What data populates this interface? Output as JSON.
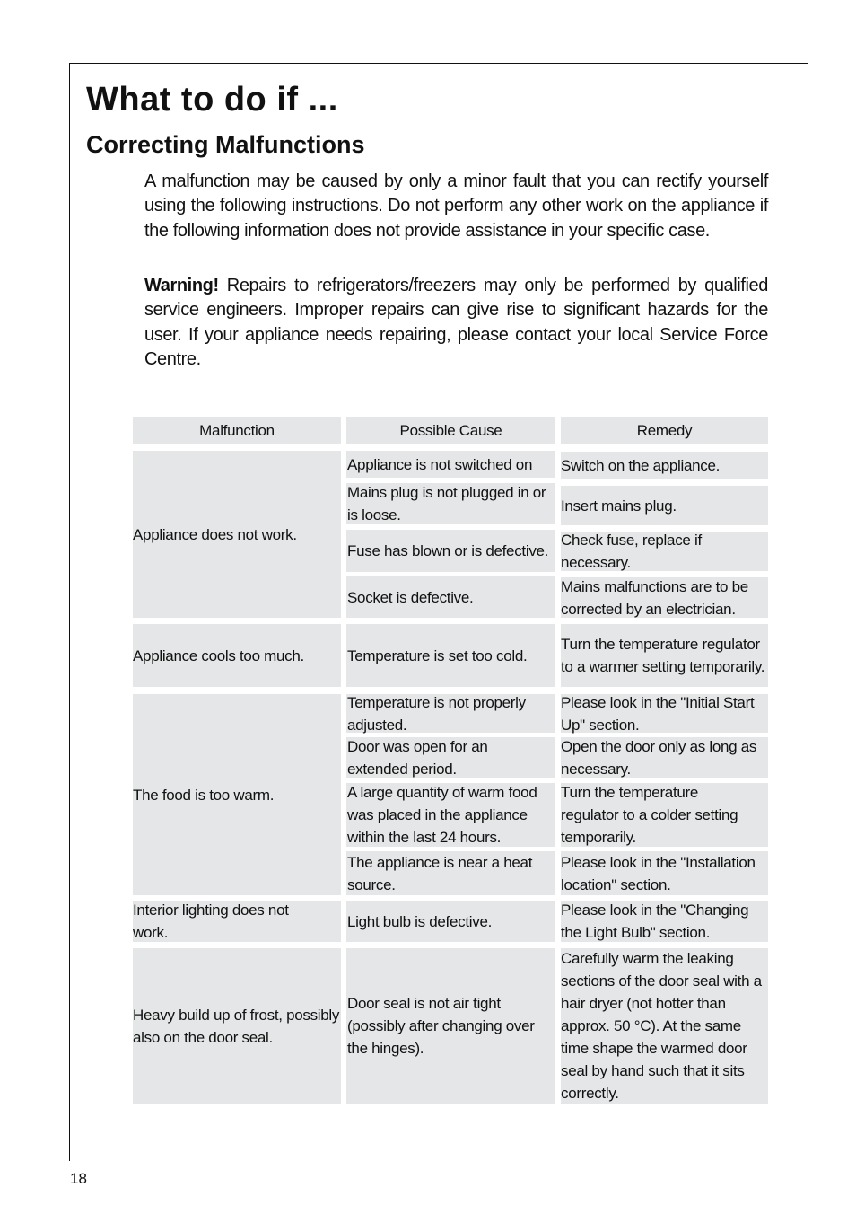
{
  "page": {
    "title": "What to do if ...",
    "subtitle": "Correcting Malfunctions",
    "intro": "A malfunction may be caused by only a minor fault that you can rectify yourself using the following instructions. Do not perform any other work on the appliance if the following information does not provide assistance in your specific case.",
    "warning_label": "Warning!",
    "warning_text": " Repairs to refrigerators/freezers may only be performed by qualified service engineers. Improper repairs can give rise to significant hazards for the user. If your appliance needs repairing, please contact your local Service Force Centre.",
    "page_number": "18"
  },
  "table": {
    "headers": [
      "Malfunction",
      "Possible Cause",
      "Remedy"
    ],
    "groups": [
      {
        "malfunction": "Appliance does not work.",
        "rows": [
          {
            "cause": "Appliance is not switched on",
            "remedy": "Switch on the appliance."
          },
          {
            "cause": "Mains plug is not plugged in or is loose.",
            "remedy": "Insert mains plug."
          },
          {
            "cause": "Fuse has blown or is defective.",
            "remedy": "Check fuse, replace if necessary."
          },
          {
            "cause": "Socket is defective.",
            "remedy": "Mains malfunctions are to be corrected by an electrician."
          }
        ]
      },
      {
        "malfunction": "Appliance cools too much.",
        "rows": [
          {
            "cause": "Temperature is set too cold.",
            "remedy": "Turn the temperature regulator to a warmer setting temporarily."
          }
        ]
      },
      {
        "malfunction": "The food is too warm.",
        "rows": [
          {
            "cause": "Temperature is not properly adjusted.",
            "remedy": "Please look in the \"Initial Start Up\" section."
          },
          {
            "cause": "Door was open for an extended period.",
            "remedy": "Open the door only as long as necessary."
          },
          {
            "cause": "A large quantity of warm food was placed in the appliance within the last 24 hours.",
            "remedy": "Turn the temperature regulator to a colder setting temporarily."
          },
          {
            "cause": "The appliance is near a heat source.",
            "remedy": "Please look in the \"Installation location\" section."
          }
        ]
      },
      {
        "malfunction": "Interior lighting does not work.",
        "rows": [
          {
            "cause": "Light bulb is defective.",
            "remedy": "Please look in the \"Changing the Light Bulb\" section."
          }
        ]
      },
      {
        "malfunction": "Heavy build up of frost, possibly also on the door seal.",
        "rows": [
          {
            "cause": "Door seal is not air tight (possibly after changing over the hinges).",
            "remedy": "Carefully warm the leaking sections of the door seal with a hair dryer (not hotter than approx. 50 °C). At the same time shape the warmed door seal by hand such that it sits correctly."
          }
        ]
      }
    ]
  }
}
